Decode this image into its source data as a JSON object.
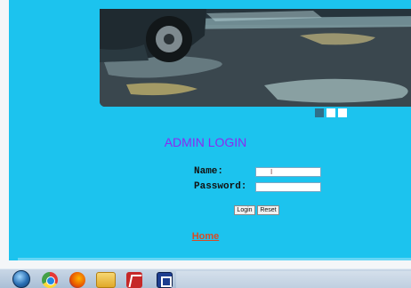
{
  "login": {
    "title": "ADMIN LOGIN",
    "name_label": "Name:",
    "password_label": "Password:",
    "name_value": "I",
    "password_value": "",
    "login_button": "Login",
    "reset_button": "Reset"
  },
  "nav": {
    "home_link": "Home"
  },
  "slider": {
    "dot_count": 3,
    "active_index": 0
  },
  "taskbar": {
    "icons": [
      "windows-start-icon",
      "chrome-icon",
      "firefox-icon",
      "folder-icon",
      "pdf-icon",
      "app-icon"
    ]
  },
  "colors": {
    "panel_background": "#1cc3ee",
    "title": "#8b2bf0",
    "home_link": "#d84b24"
  }
}
